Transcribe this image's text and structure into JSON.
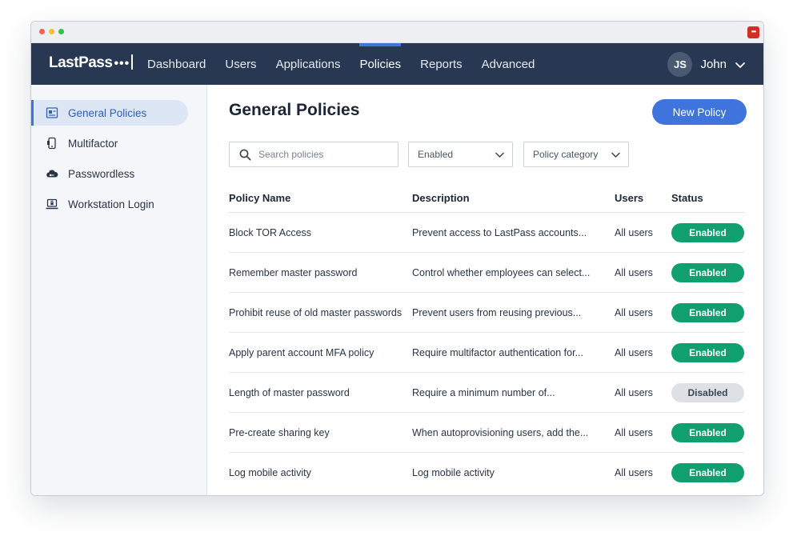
{
  "titlebar": {
    "extension_icon_text": "•••"
  },
  "brand": {
    "name": "LastPass",
    "dots": "•••"
  },
  "nav": {
    "items": [
      {
        "label": "Dashboard",
        "active": false
      },
      {
        "label": "Users",
        "active": false
      },
      {
        "label": "Applications",
        "active": false
      },
      {
        "label": "Policies",
        "active": true
      },
      {
        "label": "Reports",
        "active": false
      },
      {
        "label": "Advanced",
        "active": false
      }
    ]
  },
  "user": {
    "initials": "JS",
    "name": "John"
  },
  "sidebar": {
    "items": [
      {
        "label": "General Policies",
        "icon": "policy-icon",
        "active": true
      },
      {
        "label": "Multifactor",
        "icon": "phone-icon",
        "active": false
      },
      {
        "label": "Passwordless",
        "icon": "cloud-key-icon",
        "active": false
      },
      {
        "label": "Workstation Login",
        "icon": "laptop-lock-icon",
        "active": false
      }
    ]
  },
  "main": {
    "title": "General Policies",
    "new_button_label": "New Policy",
    "search_placeholder": "Search policies",
    "filter_status": "Enabled",
    "filter_category": "Policy category"
  },
  "table": {
    "headers": [
      "Policy Name",
      "Description",
      "Users",
      "Status"
    ],
    "rows": [
      {
        "name": "Block TOR Access",
        "description": "Prevent access to LastPass accounts...",
        "users": "All users",
        "status": "Enabled"
      },
      {
        "name": "Remember master password",
        "description": "Control whether employees can select...",
        "users": "All users",
        "status": "Enabled"
      },
      {
        "name": "Prohibit reuse of old master passwords",
        "description": "Prevent users from reusing previous...",
        "users": "All users",
        "status": "Enabled"
      },
      {
        "name": "Apply parent account MFA policy",
        "description": "Require multifactor authentication for...",
        "users": "All users",
        "status": "Enabled"
      },
      {
        "name": "Length of master password",
        "description": "Require a minimum number of...",
        "users": "All users",
        "status": "Disabled"
      },
      {
        "name": "Pre-create sharing key",
        "description": "When autoprovisioning users, add the...",
        "users": "All users",
        "status": "Enabled"
      },
      {
        "name": "Log mobile activity",
        "description": "Log mobile activity",
        "users": "All users",
        "status": "Enabled"
      }
    ]
  },
  "colors": {
    "navbar": "#283852",
    "accent": "#3f74dd",
    "enabled": "#109f6e",
    "disabled": "#dde1e6"
  }
}
